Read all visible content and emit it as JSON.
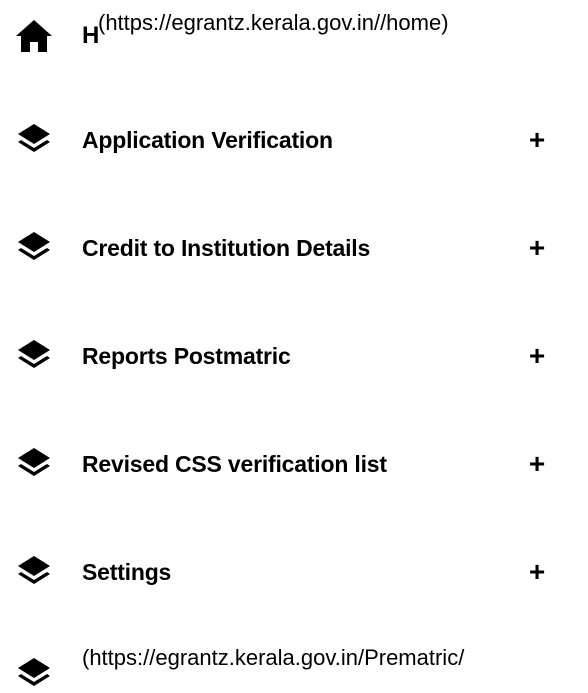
{
  "menu": {
    "home": {
      "icon": "home-icon",
      "link_text": "H",
      "link_href_text": "(https://egrantz.kerala.gov.in//home)"
    },
    "items": [
      {
        "label": "Application Verification",
        "icon": "layers-icon",
        "expand": "+"
      },
      {
        "label": "Credit to Institution Details",
        "icon": "layers-icon",
        "expand": "+"
      },
      {
        "label": "Reports Postmatric",
        "icon": "layers-icon",
        "expand": "+"
      },
      {
        "label": "Revised CSS verification list",
        "icon": "layers-icon",
        "expand": "+"
      },
      {
        "label": "Settings",
        "icon": "layers-icon",
        "expand": "+"
      }
    ],
    "prematric": {
      "icon": "layers-icon",
      "link_href_text": "(https://egrantz.kerala.gov.in/Prematric/"
    }
  },
  "colors": {
    "text": "#000000",
    "background": "#ffffff"
  }
}
